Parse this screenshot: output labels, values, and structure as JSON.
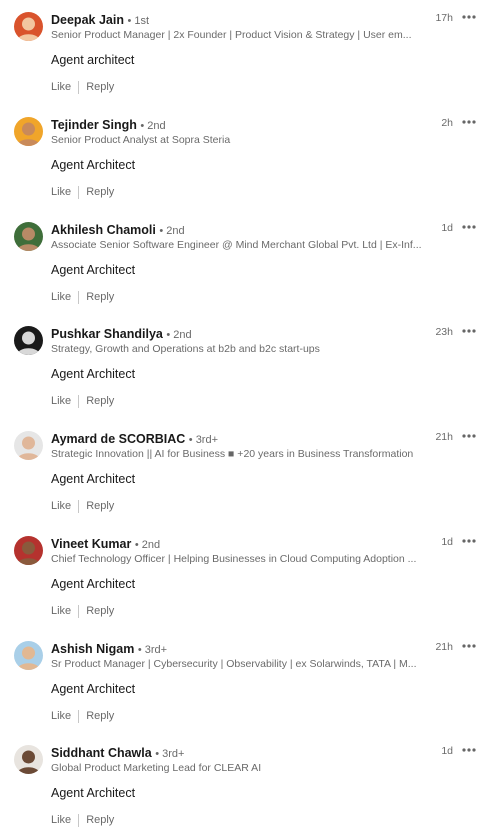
{
  "comments": [
    {
      "name": "Deepak Jain",
      "degree": "• 1st",
      "headline": "Senior Product Manager | 2x Founder | Product Vision & Strategy | User em...",
      "time": "17h",
      "text": "Agent architect",
      "like_label": "Like",
      "reply_label": "Reply",
      "avatar_icon": "avatar-icon",
      "avatar_colors": [
        "#d9532c",
        "#f2c6a0"
      ]
    },
    {
      "name": "Tejinder Singh",
      "degree": "• 2nd",
      "headline": "Senior Product Analyst at Sopra Steria",
      "time": "2h",
      "text": "Agent Architect",
      "like_label": "Like",
      "reply_label": "Reply",
      "avatar_icon": "avatar-icon",
      "avatar_colors": [
        "#f0a52a",
        "#c98a5a"
      ]
    },
    {
      "name": "Akhilesh Chamoli",
      "degree": "• 2nd",
      "headline": "Associate Senior Software Engineer @ Mind Merchant Global Pvt. Ltd | Ex-Inf...",
      "time": "1d",
      "text": "Agent Architect",
      "like_label": "Like",
      "reply_label": "Reply",
      "avatar_icon": "avatar-icon",
      "avatar_colors": [
        "#3f6e3a",
        "#b78a66"
      ]
    },
    {
      "name": "Pushkar Shandilya",
      "degree": "• 2nd",
      "headline": "Strategy, Growth and Operations at b2b and b2c start-ups",
      "time": "23h",
      "text": "Agent Architect",
      "like_label": "Like",
      "reply_label": "Reply",
      "avatar_icon": "avatar-icon",
      "avatar_colors": [
        "#1a1a1a",
        "#d8d8d8"
      ]
    },
    {
      "name": "Aymard de SCORBIAC",
      "degree": "• 3rd+",
      "headline": "Strategic Innovation || AI for Business ■ +20 years in Business Transformation",
      "time": "21h",
      "text": "Agent Architect",
      "like_label": "Like",
      "reply_label": "Reply",
      "avatar_icon": "avatar-icon",
      "avatar_colors": [
        "#e6e6e6",
        "#e0b79a"
      ]
    },
    {
      "name": "Vineet Kumar",
      "degree": "• 2nd",
      "headline": "Chief Technology Officer | Helping Businesses in Cloud Computing Adoption ...",
      "time": "1d",
      "text": "Agent Architect",
      "like_label": "Like",
      "reply_label": "Reply",
      "avatar_icon": "avatar-icon",
      "avatar_colors": [
        "#b5322e",
        "#8a5a3c"
      ]
    },
    {
      "name": "Ashish Nigam",
      "degree": "• 3rd+",
      "headline": "Sr Product Manager | Cybersecurity | Observability | ex Solarwinds, TATA | M...",
      "time": "21h",
      "text": "Agent Architect",
      "like_label": "Like",
      "reply_label": "Reply",
      "avatar_icon": "avatar-icon",
      "avatar_colors": [
        "#a9cfe8",
        "#e1b893"
      ]
    },
    {
      "name": "Siddhant Chawla",
      "degree": "• 3rd+",
      "headline": "Global Product Marketing Lead for CLEAR AI",
      "time": "1d",
      "text": "Agent Architect",
      "like_label": "Like",
      "reply_label": "Reply",
      "avatar_icon": "avatar-icon",
      "avatar_colors": [
        "#e8e4df",
        "#6b4a36"
      ]
    }
  ],
  "more_icon": "more-options-icon"
}
